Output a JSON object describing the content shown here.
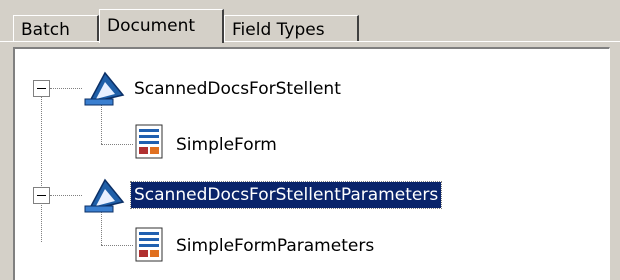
{
  "tabs": [
    {
      "label": "Batch",
      "active": false
    },
    {
      "label": "Document",
      "active": true
    },
    {
      "label": "Field Types",
      "active": false
    }
  ],
  "tree": {
    "nodes": [
      {
        "label": "ScannedDocsForStellent",
        "icon": "document-class-icon",
        "expanded": true,
        "selected": false,
        "children": [
          {
            "label": "SimpleForm",
            "icon": "form-icon"
          }
        ]
      },
      {
        "label": "ScannedDocsForStellentParameters",
        "icon": "document-class-icon",
        "expanded": true,
        "selected": true,
        "children": [
          {
            "label": "SimpleFormParameters",
            "icon": "form-icon"
          }
        ]
      }
    ]
  },
  "colors": {
    "selection": "#0a246a",
    "window": "#d4d0c8",
    "icon_blue": "#1f5fa8"
  }
}
